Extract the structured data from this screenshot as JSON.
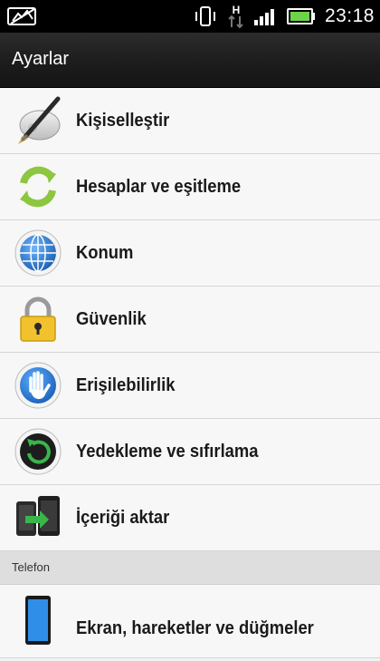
{
  "status_bar": {
    "time": "23:18",
    "icons": [
      "notification-icon",
      "vibrate-icon",
      "hspa-data-icon",
      "signal-icon",
      "battery-icon"
    ],
    "hspa_label": "H"
  },
  "header": {
    "title": "Ayarlar"
  },
  "items": [
    {
      "label": "Kişiselleştir",
      "icon": "personalize-brush-icon"
    },
    {
      "label": "Hesaplar ve eşitleme",
      "icon": "sync-icon"
    },
    {
      "label": "Konum",
      "icon": "location-globe-icon"
    },
    {
      "label": "Güvenlik",
      "icon": "lock-icon"
    },
    {
      "label": "Erişilebilirlik",
      "icon": "accessibility-hand-icon"
    },
    {
      "label": "Yedekleme ve sıfırlama",
      "icon": "backup-reset-icon"
    },
    {
      "label": "İçeriği aktar",
      "icon": "transfer-content-icon"
    }
  ],
  "section": {
    "label": "Telefon"
  },
  "phone_items": [
    {
      "label": "Ekran, hareketler ve düğmeler",
      "icon": "display-phone-icon"
    }
  ],
  "colors": {
    "status_bar_bg": "#000000",
    "title_bar_bg": "#1b1b1b",
    "list_bg": "#f7f7f7",
    "section_bg": "#dedede",
    "sync_green": "#8dc63f",
    "globe_blue": "#2b7fcf"
  }
}
